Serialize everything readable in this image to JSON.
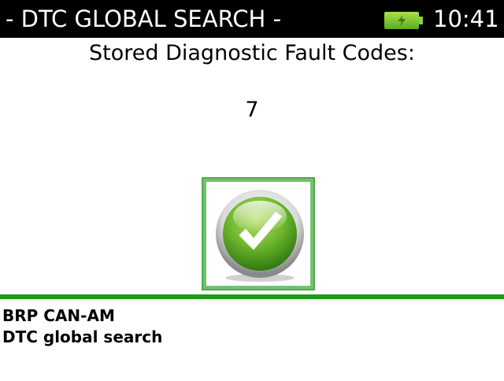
{
  "header": {
    "title": "- DTC GLOBAL SEARCH -",
    "time": "10:41",
    "battery_icon": "battery-charging-icon"
  },
  "main": {
    "subtitle": "Stored Diagnostic Fault Codes:",
    "fault_count": "7",
    "confirm_icon": "checkmark-icon"
  },
  "footer": {
    "line1": "BRP CAN-AM",
    "line2": "DTC global search"
  },
  "colors": {
    "header_bg": "#000000",
    "accent_green": "#1f9a17",
    "battery_green": "#7bc72f",
    "button_frame": "#71c26d"
  }
}
